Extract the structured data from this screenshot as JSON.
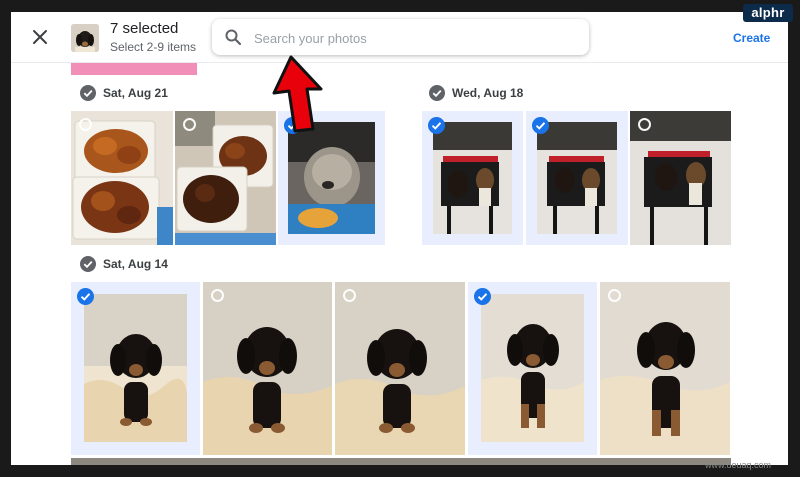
{
  "header": {
    "close_icon": "close-icon",
    "selection_title": "7 selected",
    "selection_hint": "Select 2-9 items",
    "search": {
      "placeholder": "Search your photos",
      "value": "",
      "icon": "search-icon"
    },
    "create_label": "Create"
  },
  "groups": [
    {
      "date": "Sat, Aug 21",
      "photos": [
        {
          "subject": "fried chicken food",
          "selected": false
        },
        {
          "subject": "fried chicken food",
          "selected": false
        },
        {
          "subject": "fluffy dog",
          "selected": true
        }
      ]
    },
    {
      "date": "Wed, Aug 18",
      "photos": [
        {
          "subject": "two dogs on chair",
          "selected": true
        },
        {
          "subject": "two dogs on chair",
          "selected": true
        },
        {
          "subject": "two dogs on chair",
          "selected": false
        }
      ]
    },
    {
      "date": "Sat, Aug 14",
      "photos": [
        {
          "subject": "dachshund puppy",
          "selected": true
        },
        {
          "subject": "dachshund puppy",
          "selected": false
        },
        {
          "subject": "dachshund puppy",
          "selected": false
        },
        {
          "subject": "dachshund puppy",
          "selected": true
        },
        {
          "subject": "dachshund puppy",
          "selected": false
        }
      ]
    }
  ],
  "overlays": {
    "brand_logo": "alphr",
    "watermark": "www.deuaq.com",
    "annotation_icon": "red-arrow-icon"
  },
  "colors": {
    "accent": "#1a73e8",
    "selection_bg": "#e8eefe",
    "arrow": "#e8000b"
  }
}
